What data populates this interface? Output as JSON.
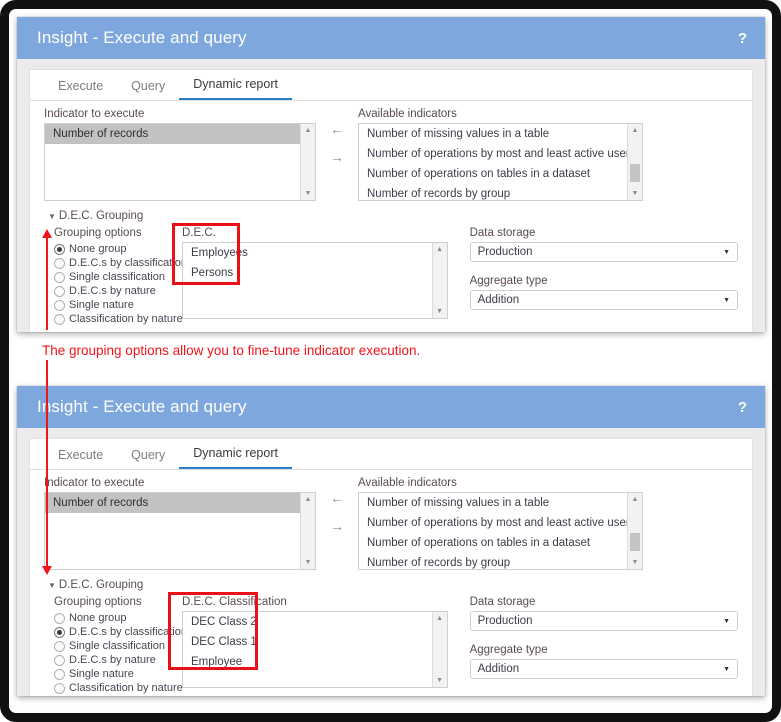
{
  "window": {
    "title": "Insight - Execute and query",
    "help_label": "?",
    "header_color": "#7da7dd"
  },
  "tabs": [
    {
      "label": "Execute",
      "active": false
    },
    {
      "label": "Query",
      "active": false
    },
    {
      "label": "Dynamic report",
      "active": true
    }
  ],
  "indicator_to_execute": {
    "label": "Indicator to execute",
    "items": [
      "Number of records"
    ],
    "selected": "Number of records"
  },
  "available_indicators": {
    "label": "Available indicators",
    "items": [
      "Number of missing values in a table",
      "Number of operations by most and least active user on a tab",
      "Number of operations on tables in a dataset",
      "Number of records by group"
    ]
  },
  "transfer_buttons": {
    "move_left": "←",
    "move_right": "→"
  },
  "grouping": {
    "section_label": "D.E.C. Grouping",
    "options_label": "Grouping options",
    "options": [
      "None group",
      "D.E.C.s by classification",
      "Single classification",
      "D.E.C.s by nature",
      "Single nature",
      "Classification by nature"
    ]
  },
  "panel_top": {
    "selected_grouping": "None group",
    "list_label": "D.E.C.",
    "list_items": [
      "Employees",
      "Persons"
    ],
    "data_storage_label": "Data storage",
    "data_storage_value": "Production",
    "aggregate_type_label": "Aggregate type",
    "aggregate_type_value": "Addition"
  },
  "panel_bottom": {
    "selected_grouping": "D.E.C.s by classification",
    "list_label": "D.E.C. Classification",
    "list_items": [
      "DEC Class 2",
      "DEC Class 1",
      "Employee"
    ],
    "data_storage_label": "Data storage",
    "data_storage_value": "Production",
    "aggregate_type_label": "Aggregate type",
    "aggregate_type_value": "Addition"
  },
  "annotation": {
    "text": "The grouping options allow you to fine-tune indicator execution.",
    "color": "#f0141b"
  }
}
